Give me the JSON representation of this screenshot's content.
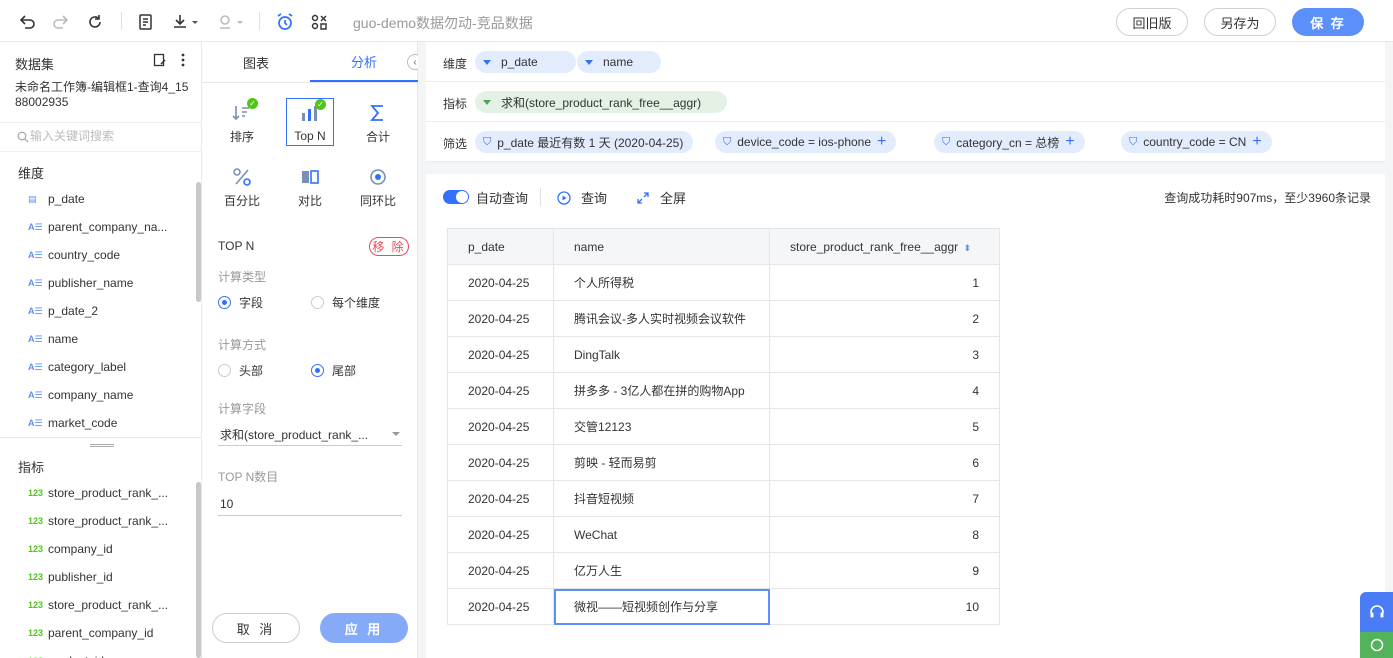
{
  "toolbar": {
    "title": "guo-demo数据勿动-竞品数据",
    "revert_label": "回旧版",
    "save_as_label": "另存为",
    "save_label": "保 存"
  },
  "dataset": {
    "header": "数据集",
    "name": "未命名工作簿-编辑框1-查询4_1588002935",
    "search_placeholder": "输入关键词搜索",
    "dimensions_title": "维度",
    "dimensions": [
      "p_date",
      "parent_company_na...",
      "country_code",
      "publisher_name",
      "p_date_2",
      "name",
      "category_label",
      "company_name",
      "market_code"
    ],
    "metrics_title": "指标",
    "metrics": [
      "store_product_rank_...",
      "store_product_rank_...",
      "company_id",
      "publisher_id",
      "store_product_rank_...",
      "parent_company_id",
      "product_id"
    ]
  },
  "analysis": {
    "tabs": [
      "图表",
      "分析"
    ],
    "functions": [
      "排序",
      "Top N",
      "合计",
      "百分比",
      "对比",
      "同环比"
    ],
    "topn_title": "TOP N",
    "remove_label": "移 除",
    "calc_type_label": "计算类型",
    "calc_type_options": [
      "字段",
      "每个维度"
    ],
    "calc_method_label": "计算方式",
    "calc_method_options": [
      "头部",
      "尾部"
    ],
    "calc_field_label": "计算字段",
    "calc_field_value": "求和(store_product_rank_...",
    "topn_count_label": "TOP N数目",
    "topn_count_value": "10",
    "cancel_label": "取 消",
    "apply_label": "应 用"
  },
  "shelves": {
    "dimension_label": "维度",
    "dimension_pills": [
      "p_date",
      "name"
    ],
    "metric_label": "指标",
    "metric_pills": [
      "求和(store_product_rank_free__aggr)"
    ],
    "filter_label": "筛选",
    "filter_pills": [
      "p_date 最近有数 1 天 (2020-04-25)",
      "device_code = ios-phone",
      "category_cn = 总榜",
      "country_code = CN"
    ]
  },
  "results": {
    "auto_query_label": "自动查询",
    "query_label": "查询",
    "fullscreen_label": "全屏",
    "status": "查询成功耗时907ms，至少3960条记录",
    "columns": [
      "p_date",
      "name",
      "store_product_rank_free__aggr"
    ],
    "rows": [
      [
        "2020-04-25",
        "个人所得税",
        "1"
      ],
      [
        "2020-04-25",
        "腾讯会议-多人实时视频会议软件",
        "2"
      ],
      [
        "2020-04-25",
        "DingTalk",
        "3"
      ],
      [
        "2020-04-25",
        "拼多多 - 3亿人都在拼的购物App",
        "4"
      ],
      [
        "2020-04-25",
        "交管12123",
        "5"
      ],
      [
        "2020-04-25",
        "剪映 - 轻而易剪",
        "6"
      ],
      [
        "2020-04-25",
        "抖音短视频",
        "7"
      ],
      [
        "2020-04-25",
        "WeChat",
        "8"
      ],
      [
        "2020-04-25",
        "亿万人生",
        "9"
      ],
      [
        "2020-04-25",
        "微视——短视频创作与分享",
        "10"
      ]
    ]
  },
  "colors": {
    "accent": "#3370ff",
    "save": "#5b8ff9",
    "metric": "#52c41a"
  }
}
